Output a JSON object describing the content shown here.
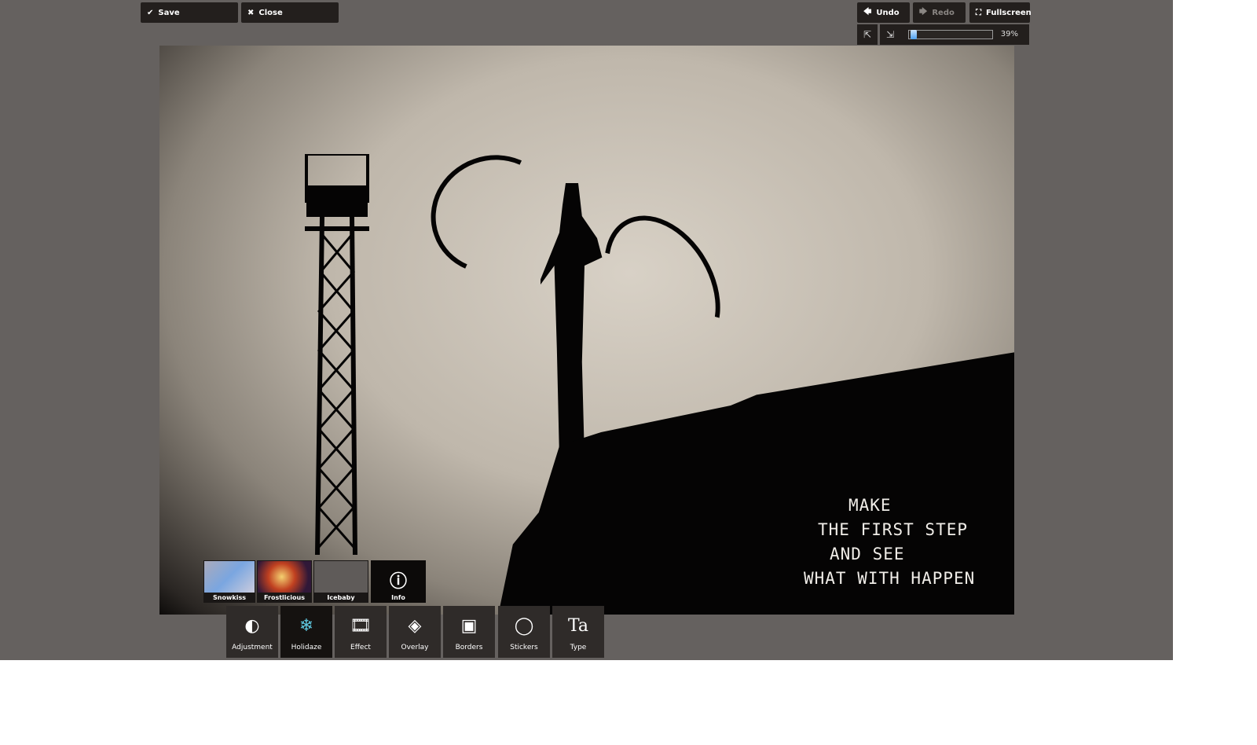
{
  "toolbar": {
    "save": "Save",
    "close": "Close",
    "undo": "Undo",
    "redo": "Redo",
    "fullscreen": "Fullscreen"
  },
  "zoom": {
    "value": "39%",
    "level": 0.39
  },
  "photo": {
    "quote": [
      "MAKE",
      "THE FIRST STEP",
      "AND SEE",
      "WHAT WITH HAPPEN"
    ]
  },
  "presets": [
    {
      "label": "Snowkiss"
    },
    {
      "label": "Frostlicious"
    },
    {
      "label": "Icebaby"
    },
    {
      "label": "Info"
    }
  ],
  "tools": [
    {
      "label": "Adjustment",
      "icon": "toggle-icon"
    },
    {
      "label": "Holidaze",
      "icon": "snowflake-icon",
      "active": true
    },
    {
      "label": "Effect",
      "icon": "film-icon"
    },
    {
      "label": "Overlay",
      "icon": "layers-icon"
    },
    {
      "label": "Borders",
      "icon": "border-frame-icon"
    },
    {
      "label": "Stickers",
      "icon": "sticker-icon"
    },
    {
      "label": "Type",
      "icon": "type-icon"
    }
  ],
  "colors": {
    "background": "#65615f",
    "button": "#231f1d",
    "accent": "#4aa0f0"
  }
}
